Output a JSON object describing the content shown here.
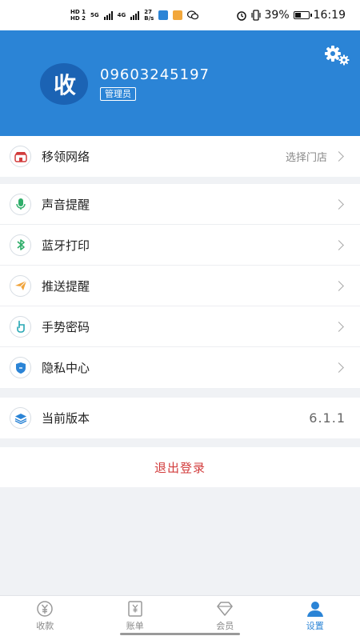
{
  "status_bar": {
    "hd1": "HD 1",
    "hd2": "HD 2",
    "net": "5G",
    "net2": "4G",
    "speed_value": "27",
    "speed_unit": "B/s",
    "battery": "39%",
    "time": "16:19"
  },
  "header": {
    "logo_text": "收",
    "user_id": "09603245197",
    "role": "管理员"
  },
  "store": {
    "label": "移领网络",
    "action": "选择门店"
  },
  "settings_items": [
    {
      "label": "声音提醒",
      "icon": "microphone-icon",
      "color": "#2fae6a"
    },
    {
      "label": "蓝牙打印",
      "icon": "bluetooth-icon",
      "color": "#2fae6a"
    },
    {
      "label": "推送提醒",
      "icon": "paper-plane-icon",
      "color": "#f0a33a"
    },
    {
      "label": "手势密码",
      "icon": "hand-icon",
      "color": "#26a7b4"
    },
    {
      "label": "隐私中心",
      "icon": "shield-icon",
      "color": "#2b84d6"
    }
  ],
  "version": {
    "label": "当前版本",
    "value": "6.1.1"
  },
  "logout_label": "退出登录",
  "nav": [
    {
      "label": "收款",
      "icon": "yuan-circle-icon"
    },
    {
      "label": "账单",
      "icon": "bill-icon"
    },
    {
      "label": "会员",
      "icon": "diamond-icon"
    },
    {
      "label": "设置",
      "icon": "user-icon"
    }
  ],
  "colors": {
    "brand": "#2b84d6",
    "logout": "#d23c3c"
  }
}
